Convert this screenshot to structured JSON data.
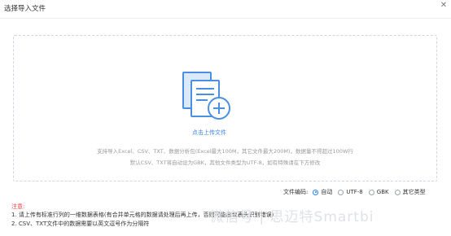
{
  "dialog": {
    "title": "选择导入文件",
    "close_icon": "close-icon"
  },
  "upload": {
    "icon": "file-add-icon",
    "link_text": "点击上传文件",
    "desc_line1": "支持导入Excel、CSV、TXT、数据分析包(Excel最大100M，其它文件最大200M)，数据量不得超过100W行",
    "desc_line2": "默认CSV、TXT将自动设为GBK，其他文件类型为UTF-8，如有特殊请在下方修改"
  },
  "encoding": {
    "label": "文件编码:",
    "options": [
      {
        "label": "自动",
        "selected": true
      },
      {
        "label": "UTF-8",
        "selected": false
      },
      {
        "label": "GBK",
        "selected": false
      },
      {
        "label": "其它类型",
        "selected": false
      }
    ]
  },
  "notice": {
    "title": "注意:",
    "line1": "1. 请上传有标准行列的一维数据表格(有合并单元格的数据请处理后再上传，否则可能出现表头识别错误)",
    "line2": "2. CSV、TXT文件中的数据需要以英文逗号作为分隔符"
  },
  "watermark": "微信号 | 思迈特Smartbi",
  "colors": {
    "accent": "#3b86e6",
    "icon_light": "#d5e6fa",
    "notice_title": "#e8403a"
  }
}
